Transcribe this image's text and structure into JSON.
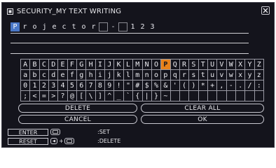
{
  "title": "SECURITY_MY TEXT WRITING",
  "input_chars": [
    "P",
    "r",
    "o",
    "j",
    "e",
    "c",
    "t",
    "o",
    "r",
    " ",
    "-",
    " ",
    "1",
    "2",
    "3"
  ],
  "keyboard_rows": [
    [
      "A",
      "B",
      "C",
      "D",
      "E",
      "F",
      "G",
      "H",
      "I",
      "J",
      "K",
      "L",
      "M",
      "N",
      "O",
      "P",
      "Q",
      "R",
      "S",
      "T",
      "U",
      "V",
      "W",
      "X",
      "Y",
      "Z"
    ],
    [
      "a",
      "b",
      "c",
      "d",
      "e",
      "f",
      "g",
      "h",
      "i",
      "j",
      "k",
      "l",
      "m",
      "n",
      "o",
      "p",
      "q",
      "r",
      "s",
      "t",
      "u",
      "v",
      "w",
      "x",
      "y",
      "z"
    ],
    [
      "0",
      "1",
      "2",
      "3",
      "4",
      "5",
      "6",
      "7",
      "8",
      "9",
      "!",
      "\"",
      "#",
      "$",
      "%",
      "&",
      "'",
      "(",
      ")",
      "*",
      "+",
      ",",
      "-",
      ".",
      "/",
      ":"
    ],
    [
      ";",
      "<",
      "=",
      ">",
      "?",
      "@",
      "[",
      "\\",
      "]",
      "^",
      "_",
      "`",
      "{",
      "|",
      "}",
      "~",
      "",
      "",
      "",
      "",
      "",
      "",
      "",
      "",
      "",
      ""
    ]
  ],
  "selected_key": "P",
  "buttons": {
    "delete": "DELETE",
    "clear_all": "CLEAR ALL",
    "cancel": "CANCEL",
    "ok": "OK"
  },
  "help": {
    "enter_label": "ENTER",
    "set_text": ":SET",
    "reset_label": "RESET",
    "delete_text": ":DELETE"
  },
  "colors": {
    "background": "#14141c",
    "cursor": "#4a78c8",
    "selected_key": "#e8821a"
  }
}
